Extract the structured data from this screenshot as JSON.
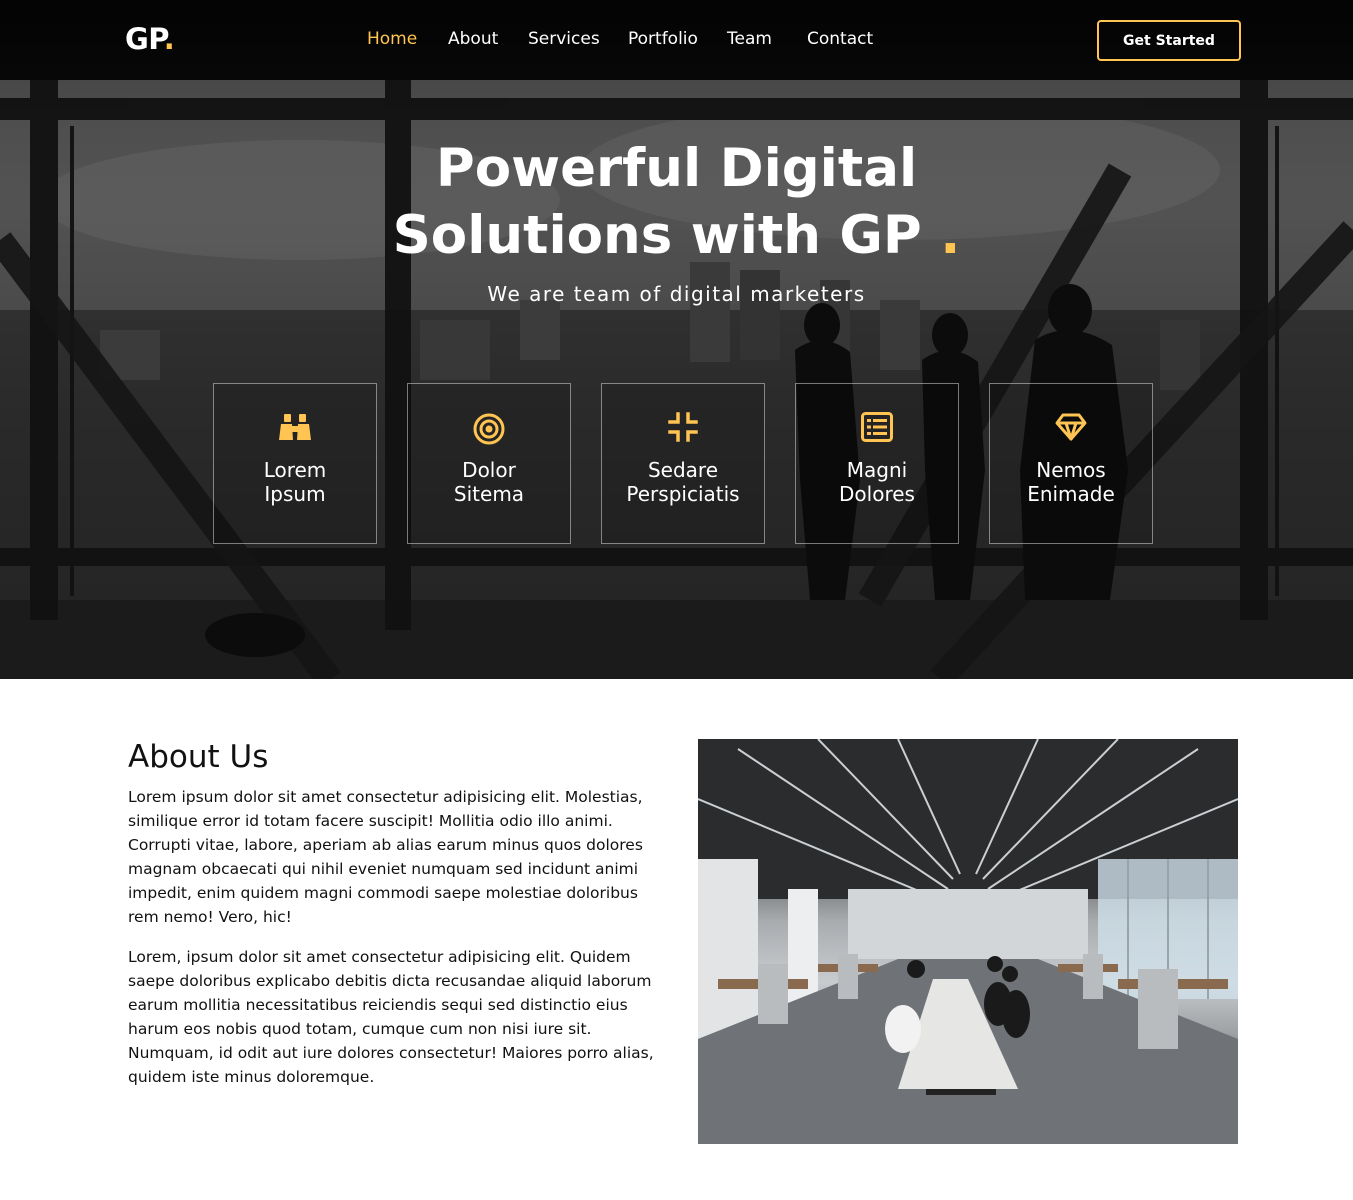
{
  "brand": {
    "name": "GP",
    "dot": "."
  },
  "nav": {
    "items": [
      {
        "label": "Home",
        "active": true
      },
      {
        "label": "About",
        "active": false
      },
      {
        "label": "Services",
        "active": false
      },
      {
        "label": "Portfolio",
        "active": false
      },
      {
        "label": "Team",
        "active": false
      },
      {
        "label": "Contact",
        "active": false
      }
    ],
    "cta_label": "Get Started"
  },
  "hero": {
    "title_line1": "Powerful Digital",
    "title_line2": "Solutions with GP",
    "title_dot": ".",
    "subtitle": "We are team of digital marketers",
    "features": [
      {
        "line1": "Lorem",
        "line2": "Ipsum",
        "icon": "binoculars-icon"
      },
      {
        "line1": "Dolor",
        "line2": "Sitema",
        "icon": "target-icon"
      },
      {
        "line1": "Sedare",
        "line2": "Perspiciatis",
        "icon": "compress-icon"
      },
      {
        "line1": "Magni",
        "line2": "Dolores",
        "icon": "list-icon"
      },
      {
        "line1": "Nemos",
        "line2": "Enimade",
        "icon": "diamond-icon"
      }
    ]
  },
  "about": {
    "title": "About Us",
    "paragraph1": "Lorem ipsum dolor sit amet consectetur adipisicing elit. Molestias, similique error id totam facere suscipit! Mollitia odio illo animi. Corrupti vitae, labore, aperiam ab alias earum minus quos dolores magnam obcaecati qui nihil eveniet numquam sed incidunt animi impedit, enim quidem magni commodi saepe molestiae doloribus rem nemo! Vero, hic!",
    "paragraph2": "Lorem, ipsum dolor sit amet consectetur adipisicing elit. Quidem saepe doloribus explicabo debitis dicta recusandae aliquid laborum earum mollitia necessitatibus reiciendis sequi sed distinctio eius harum eos nobis quod totam, cumque cum non nisi iure sit. Numquam, id odit aut iure dolores consectetur! Maiores porro alias, quidem iste minus doloremque."
  },
  "colors": {
    "accent": "#ffc451",
    "nav_bg": "#000000",
    "text": "#111111"
  }
}
